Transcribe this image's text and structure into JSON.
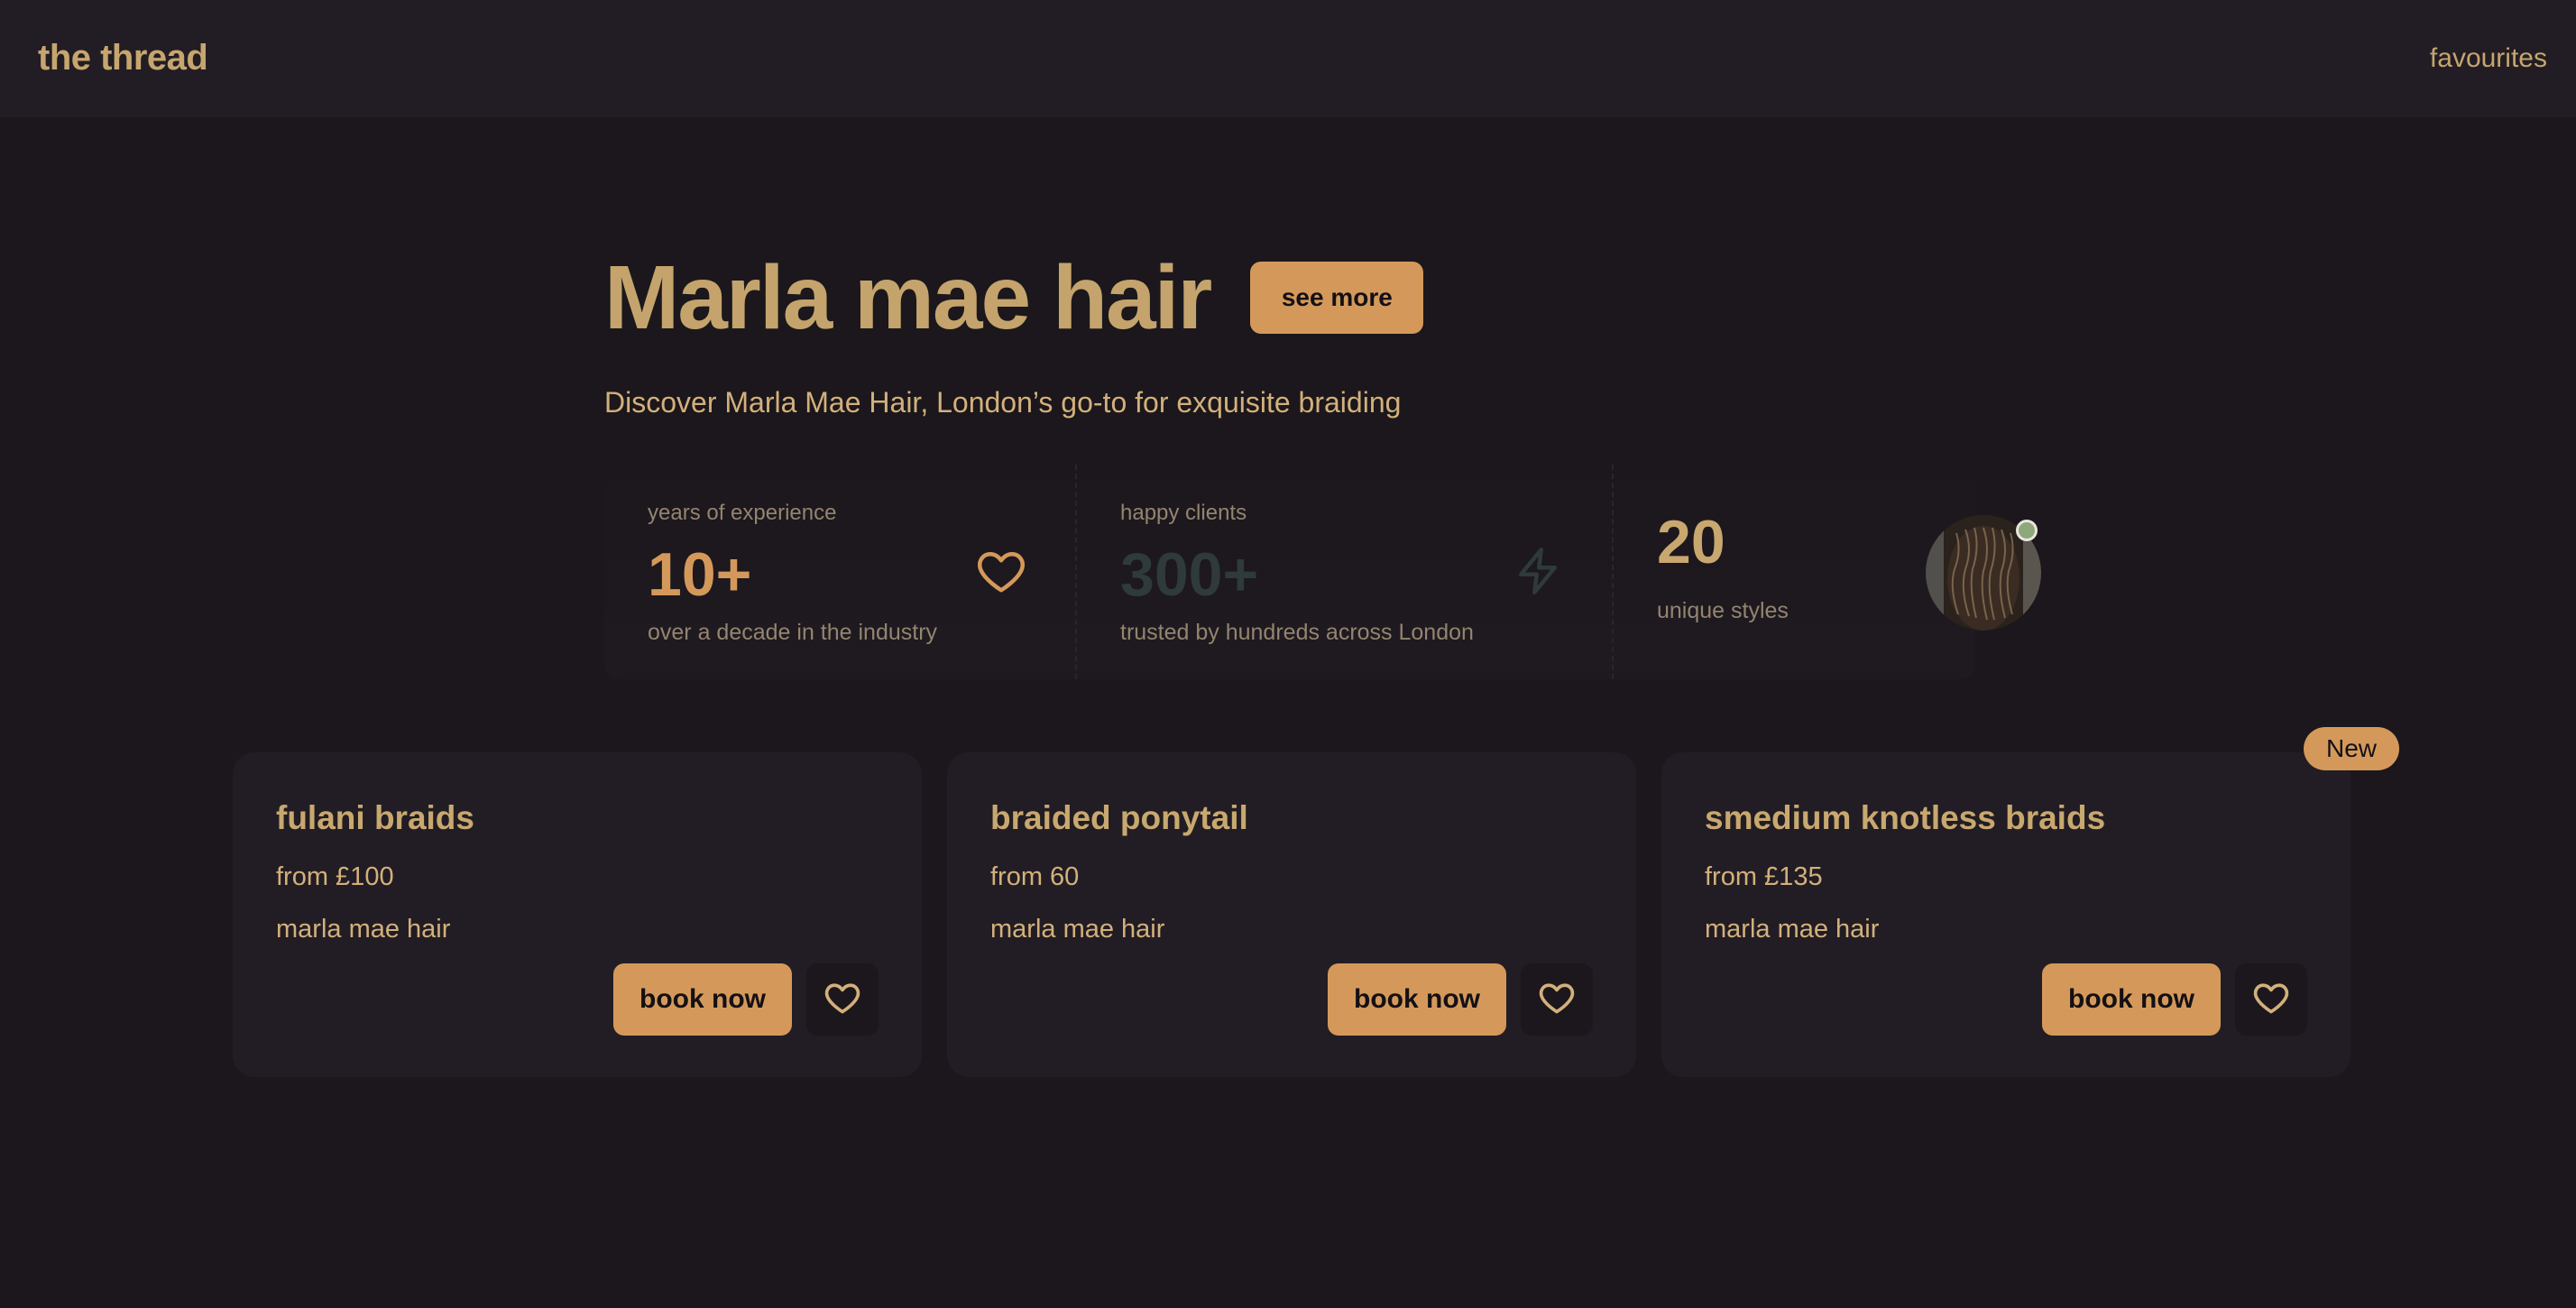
{
  "app": {
    "brand": "the thread"
  },
  "nav": {
    "favourites": "favourites"
  },
  "hero": {
    "title": "Marla mae hair",
    "see_more": "see more",
    "subtitle": "Discover Marla Mae Hair, London’s go-to for exquisite braiding"
  },
  "stats": [
    {
      "label": "years of experience",
      "value": "10+",
      "description": "over a decade in the industry",
      "icon": "heart-icon",
      "color": "#d4995a"
    },
    {
      "label": "happy clients",
      "value": "300+",
      "description": "trusted by hundreds across London",
      "icon": "lightning-icon",
      "color": "#2f3a3a"
    },
    {
      "value": "20",
      "description": "unique styles",
      "color": "#c8a86f"
    }
  ],
  "cards": [
    {
      "title": "fulani braids",
      "price": "from £100",
      "provider": "marla mae hair",
      "book": "book now"
    },
    {
      "title": "braided ponytail",
      "price": "from 60",
      "provider": "marla mae hair",
      "book": "book now"
    },
    {
      "title": "smedium knotless braids",
      "price": "from £135",
      "provider": "marla mae hair",
      "book": "book now",
      "badge": "New"
    }
  ],
  "colors": {
    "background": "#1b171c",
    "surface": "#221d24",
    "accent": "#d4995a",
    "text": "#c8a86f"
  }
}
